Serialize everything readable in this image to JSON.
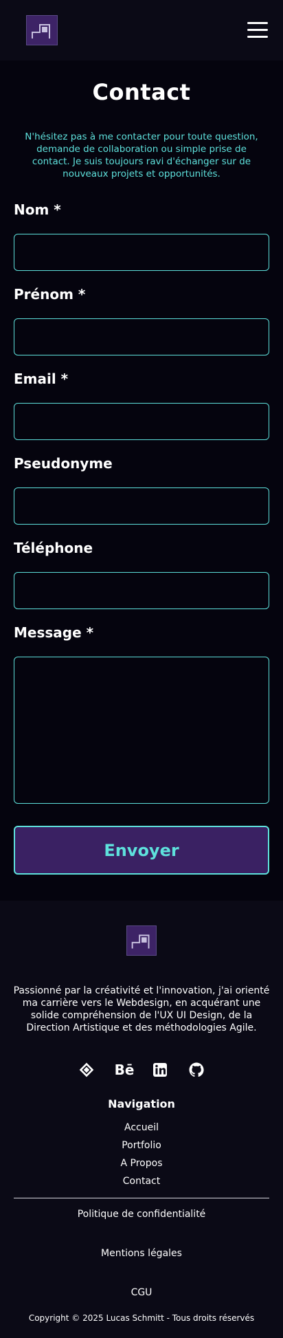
{
  "header": {
    "logo": "site-logo",
    "menu_icon": "hamburger-menu-icon"
  },
  "main": {
    "title": "Contact",
    "intro": "N'hésitez pas à me contacter pour toute question, demande de collaboration ou simple prise de contact. Je suis toujours ravi d'échanger sur de nouveaux projets et opportunités.",
    "fields": [
      {
        "label": "Nom *",
        "value": "",
        "placeholder": ""
      },
      {
        "label": "Prénom *",
        "value": "",
        "placeholder": ""
      },
      {
        "label": "Email *",
        "value": "",
        "placeholder": ""
      },
      {
        "label": "Pseudonyme",
        "value": "",
        "placeholder": ""
      },
      {
        "label": "Téléphone",
        "value": "",
        "placeholder": ""
      },
      {
        "label": "Message *",
        "value": "",
        "placeholder": ""
      }
    ],
    "submit_label": "Envoyer"
  },
  "footer": {
    "description": "Passionné par la créativité et l'innovation, j'ai orienté ma carrière vers le Webdesign, en acquérant une solide compréhension de l'UX UI Design, de la Direction Artistique et des méthodologies Agile.",
    "socials": [
      "dribbble-icon",
      "behance-icon",
      "linkedin-icon",
      "github-icon"
    ],
    "behance_text": "Bē",
    "nav_title": "Navigation",
    "nav_links": [
      "Accueil",
      "Portfolio",
      "A Propos",
      "Contact"
    ],
    "legal_links": [
      "Politique de confidentialité",
      "Mentions légales",
      "CGU"
    ],
    "copyright": "Copyright © 2025 Lucas Schmitt - Tous droits réservés"
  },
  "colors": {
    "accent": "#5ee1dc",
    "purple": "#3a2163",
    "background": "#05040e",
    "surface": "#0b0a16"
  }
}
